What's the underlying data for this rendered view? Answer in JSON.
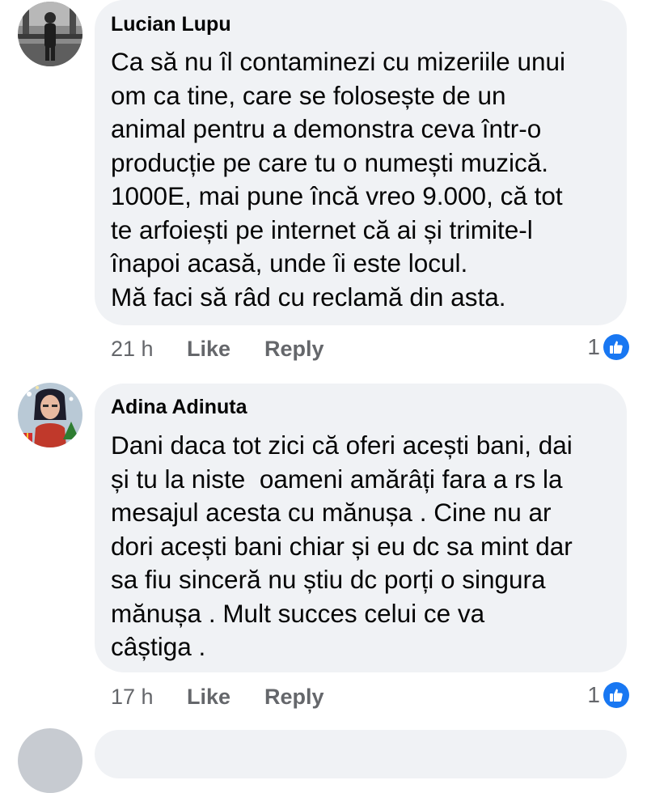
{
  "comments": [
    {
      "author": "Lucian Lupu",
      "lines": [
        "Ca să nu îl contaminezi cu mizeriile unui",
        "om ca tine, care se folosește de un",
        "animal pentru a demonstra ceva într-o",
        "producție pe care tu o numești muzică.",
        "1000E, mai pune încă vreo 9.000, că tot",
        "te arfoiești pe internet că ai și trimite-l",
        "înapoi acasă, unde îi este locul.",
        "Mă faci să râd cu reclamă din asta."
      ],
      "time": "21 h",
      "like_label": "Like",
      "reply_label": "Reply",
      "reaction_count": "1"
    },
    {
      "author": "Adina Adinuta",
      "lines": [
        "Dani daca tot zici că oferi acești bani, dai",
        "și tu la niste  oameni amărâți fara a rs la",
        "mesajul acesta cu mănușa . Cine nu ar",
        "dori acești bani chiar și eu dc sa mint dar",
        "sa fiu sinceră nu știu dc porți o singura",
        "mănușa . Mult succes celui ce va",
        "câștiga ."
      ],
      "time": "17 h",
      "like_label": "Like",
      "reply_label": "Reply",
      "reaction_count": "1"
    }
  ],
  "colors": {
    "bubble": "#f0f2f5",
    "meta_text": "#65676b",
    "like_badge": "#1877f2"
  }
}
